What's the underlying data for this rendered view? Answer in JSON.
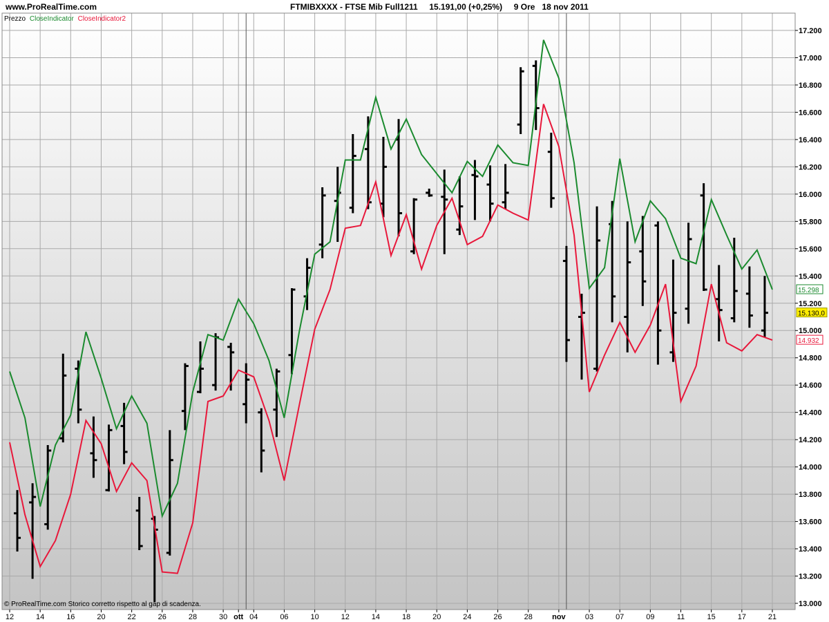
{
  "header": {
    "site": "www.ProRealTime.com",
    "title": "FTMIBXXXX - FTSE Mib Full1211     15.191,00 (+0,25%)     9 Ore   18 nov 2011"
  },
  "legend": {
    "price_label": "Prezzo",
    "ind1_label": "CloseIndicator",
    "ind2_label": "CloseIndicator2"
  },
  "footer": {
    "text": "© ProRealTime.com  Storico corretto rispetto al gap di scadenza."
  },
  "badges": {
    "ind1": "15.298",
    "price": "15.130,0",
    "ind2": "14.932"
  },
  "colors": {
    "ind1": "#1a8a2e",
    "ind2": "#e8173a",
    "price": "#000000",
    "badge_price_bg": "#ffee00"
  },
  "chart_data": {
    "type": "line",
    "y_axis": {
      "range": [
        12900,
        17250
      ],
      "ticks": [
        {
          "v": 13000,
          "label": "13.000"
        },
        {
          "v": 13200,
          "label": "13.200"
        },
        {
          "v": 13400,
          "label": "13.400"
        },
        {
          "v": 13600,
          "label": "13.600"
        },
        {
          "v": 13800,
          "label": "13.800"
        },
        {
          "v": 14000,
          "label": "14.000"
        },
        {
          "v": 14200,
          "label": "14.200"
        },
        {
          "v": 14400,
          "label": "14.400"
        },
        {
          "v": 14600,
          "label": "14.600"
        },
        {
          "v": 14800,
          "label": "14.800"
        },
        {
          "v": 15000,
          "label": "15.000"
        },
        {
          "v": 15200,
          "label": "15.200"
        },
        {
          "v": 15400,
          "label": "15.400"
        },
        {
          "v": 15600,
          "label": "15.600"
        },
        {
          "v": 15800,
          "label": "15.800"
        },
        {
          "v": 16000,
          "label": "16.000"
        },
        {
          "v": 16200,
          "label": "16.200"
        },
        {
          "v": 16400,
          "label": "16.400"
        },
        {
          "v": 16600,
          "label": "16.600"
        },
        {
          "v": 16800,
          "label": "16.800"
        },
        {
          "v": 17000,
          "label": "17.000"
        },
        {
          "v": 17200,
          "label": "17.200"
        }
      ],
      "bold_every": 5000
    },
    "x_axis": {
      "range": [
        -0.3,
        51.2
      ],
      "ticks": [
        {
          "i": 0,
          "label": "12"
        },
        {
          "i": 2,
          "label": "14"
        },
        {
          "i": 4,
          "label": "16"
        },
        {
          "i": 6,
          "label": "20"
        },
        {
          "i": 8,
          "label": "22"
        },
        {
          "i": 10,
          "label": "26"
        },
        {
          "i": 12,
          "label": "28"
        },
        {
          "i": 14,
          "label": "30"
        },
        {
          "i": 15,
          "label": "ott",
          "bold": true
        },
        {
          "i": 16,
          "label": "04"
        },
        {
          "i": 18,
          "label": "06"
        },
        {
          "i": 20,
          "label": "10"
        },
        {
          "i": 22,
          "label": "12"
        },
        {
          "i": 24,
          "label": "14"
        },
        {
          "i": 26,
          "label": "18"
        },
        {
          "i": 28,
          "label": "20"
        },
        {
          "i": 30,
          "label": "24"
        },
        {
          "i": 32,
          "label": "26"
        },
        {
          "i": 34,
          "label": "28"
        },
        {
          "i": 36,
          "label": "nov",
          "bold": true
        },
        {
          "i": 38,
          "label": "03"
        },
        {
          "i": 40,
          "label": "07"
        },
        {
          "i": 42,
          "label": "09"
        },
        {
          "i": 44,
          "label": "11"
        },
        {
          "i": 46,
          "label": "15"
        },
        {
          "i": 48,
          "label": "17"
        },
        {
          "i": 50,
          "label": "21"
        }
      ],
      "month_separators": [
        15.5,
        36.5
      ]
    },
    "price_bars": [
      {
        "i": 0.5,
        "h": 13830,
        "l": 13380,
        "o": 13660,
        "c": 13480
      },
      {
        "i": 1.5,
        "h": 13880,
        "l": 13180,
        "o": 13740,
        "c": 13780
      },
      {
        "i": 2.5,
        "h": 14160,
        "l": 13540,
        "o": 13580,
        "c": 14120
      },
      {
        "i": 3.5,
        "h": 14830,
        "l": 14180,
        "o": 14210,
        "c": 14670
      },
      {
        "i": 4.5,
        "h": 14780,
        "l": 14320,
        "o": 14720,
        "c": 14420
      },
      {
        "i": 5.5,
        "h": 14370,
        "l": 13920,
        "o": 14100,
        "c": 14050
      },
      {
        "i": 6.5,
        "h": 14310,
        "l": 13820,
        "o": 13830,
        "c": 14270
      },
      {
        "i": 7.5,
        "h": 14470,
        "l": 14020,
        "o": 14300,
        "c": 14110
      },
      {
        "i": 8.5,
        "h": 13780,
        "l": 13390,
        "o": 13680,
        "c": 13420
      },
      {
        "i": 9.5,
        "h": 13640,
        "l": 13010,
        "o": 13620,
        "c": 13540
      },
      {
        "i": 10.5,
        "h": 14270,
        "l": 13350,
        "o": 13370,
        "c": 14050
      },
      {
        "i": 11.5,
        "h": 14760,
        "l": 14270,
        "o": 14410,
        "c": 14740
      },
      {
        "i": 12.5,
        "h": 14920,
        "l": 14540,
        "o": 14550,
        "c": 14720
      },
      {
        "i": 13.5,
        "h": 14980,
        "l": 14560,
        "o": 14600,
        "c": 14950
      },
      {
        "i": 14.5,
        "h": 14910,
        "l": 14560,
        "o": 14880,
        "c": 14840
      },
      {
        "i": 15.5,
        "h": 14760,
        "l": 14320,
        "o": 14460,
        "c": 14640
      },
      {
        "i": 16.5,
        "h": 14430,
        "l": 13960,
        "o": 14400,
        "c": 14120
      },
      {
        "i": 17.5,
        "h": 14720,
        "l": 14220,
        "o": 14420,
        "c": 14700
      },
      {
        "i": 18.5,
        "h": 15310,
        "l": 14680,
        "o": 14820,
        "c": 15300
      },
      {
        "i": 19.5,
        "h": 15530,
        "l": 15150,
        "o": 15250,
        "c": 15460
      },
      {
        "i": 20.5,
        "h": 16050,
        "l": 15530,
        "o": 15630,
        "c": 15990
      },
      {
        "i": 21.5,
        "h": 16200,
        "l": 15650,
        "o": 15950,
        "c": 16010
      },
      {
        "i": 22.5,
        "h": 16440,
        "l": 15860,
        "o": 15900,
        "c": 16280
      },
      {
        "i": 23.5,
        "h": 16570,
        "l": 15890,
        "o": 16330,
        "c": 15940
      },
      {
        "i": 24.5,
        "h": 16420,
        "l": 15830,
        "o": 15930,
        "c": 16200
      },
      {
        "i": 25.5,
        "h": 16550,
        "l": 15690,
        "o": 16400,
        "c": 15860
      },
      {
        "i": 26.5,
        "h": 15970,
        "l": 15560,
        "o": 15580,
        "c": 15960
      },
      {
        "i": 27.5,
        "h": 16040,
        "l": 15980,
        "o": 16010,
        "c": 15990
      },
      {
        "i": 28.5,
        "h": 16180,
        "l": 15560,
        "o": 15980,
        "c": 15960
      },
      {
        "i": 29.5,
        "h": 16130,
        "l": 15700,
        "o": 15740,
        "c": 15910
      },
      {
        "i": 30.5,
        "h": 16250,
        "l": 15810,
        "o": 16140,
        "c": 16130
      },
      {
        "i": 31.5,
        "h": 16210,
        "l": 15800,
        "o": 16070,
        "c": 15930
      },
      {
        "i": 32.5,
        "h": 16220,
        "l": 15890,
        "o": 15940,
        "c": 16010
      },
      {
        "i": 33.5,
        "h": 16930,
        "l": 16440,
        "o": 16510,
        "c": 16900
      },
      {
        "i": 34.5,
        "h": 16980,
        "l": 16470,
        "o": 16940,
        "c": 16630
      },
      {
        "i": 35.5,
        "h": 16450,
        "l": 15900,
        "o": 16310,
        "c": 15970
      },
      {
        "i": 36.5,
        "h": 15620,
        "l": 14770,
        "o": 15510,
        "c": 14930
      },
      {
        "i": 37.5,
        "h": 15270,
        "l": 14640,
        "o": 15100,
        "c": 15130
      },
      {
        "i": 38.5,
        "h": 15910,
        "l": 14700,
        "o": 14720,
        "c": 15660
      },
      {
        "i": 39.5,
        "h": 15950,
        "l": 15060,
        "o": 15780,
        "c": 15250
      },
      {
        "i": 40.5,
        "h": 15800,
        "l": 14840,
        "o": 15100,
        "c": 15500
      },
      {
        "i": 41.5,
        "h": 15840,
        "l": 15180,
        "o": 15580,
        "c": 15360
      },
      {
        "i": 42.5,
        "h": 15800,
        "l": 14750,
        "o": 15770,
        "c": 15000
      },
      {
        "i": 43.5,
        "h": 15520,
        "l": 14770,
        "o": 14840,
        "c": 15130
      },
      {
        "i": 44.5,
        "h": 15790,
        "l": 15050,
        "o": 15160,
        "c": 15670
      },
      {
        "i": 45.5,
        "h": 16080,
        "l": 15290,
        "o": 15990,
        "c": 15300
      },
      {
        "i": 46.5,
        "h": 15480,
        "l": 14920,
        "o": 15230,
        "c": 15150
      },
      {
        "i": 47.5,
        "h": 15680,
        "l": 15060,
        "o": 15090,
        "c": 15290
      },
      {
        "i": 48.5,
        "h": 15470,
        "l": 15020,
        "o": 15270,
        "c": 15110
      },
      {
        "i": 49.5,
        "h": 15400,
        "l": 14950,
        "o": 15000,
        "c": 15130
      }
    ],
    "series": [
      {
        "name": "CloseIndicator",
        "color": "#1a8a2e",
        "points": [
          [
            0,
            14700
          ],
          [
            1,
            14360
          ],
          [
            2,
            13710
          ],
          [
            3,
            14160
          ],
          [
            4,
            14380
          ],
          [
            5,
            14990
          ],
          [
            6,
            14650
          ],
          [
            7,
            14280
          ],
          [
            8,
            14520
          ],
          [
            9,
            14320
          ],
          [
            10,
            13640
          ],
          [
            11,
            13880
          ],
          [
            12,
            14550
          ],
          [
            13,
            14970
          ],
          [
            14,
            14930
          ],
          [
            15,
            15230
          ],
          [
            16,
            15050
          ],
          [
            17,
            14780
          ],
          [
            18,
            14360
          ],
          [
            19,
            15000
          ],
          [
            20,
            15560
          ],
          [
            21,
            15650
          ],
          [
            22,
            16250
          ],
          [
            23,
            16250
          ],
          [
            24,
            16710
          ],
          [
            25,
            16330
          ],
          [
            26,
            16550
          ],
          [
            27,
            16290
          ],
          [
            28,
            16150
          ],
          [
            29,
            16010
          ],
          [
            30,
            16240
          ],
          [
            31,
            16130
          ],
          [
            32,
            16360
          ],
          [
            33,
            16230
          ],
          [
            34,
            16210
          ],
          [
            35,
            17130
          ],
          [
            36,
            16850
          ],
          [
            37,
            16230
          ],
          [
            38,
            15310
          ],
          [
            39,
            15460
          ],
          [
            40,
            16260
          ],
          [
            41,
            15650
          ],
          [
            42,
            15950
          ],
          [
            43,
            15820
          ],
          [
            44,
            15530
          ],
          [
            45,
            15490
          ],
          [
            46,
            15960
          ],
          [
            47,
            15700
          ],
          [
            48,
            15450
          ],
          [
            49,
            15590
          ],
          [
            50,
            15300
          ]
        ]
      },
      {
        "name": "CloseIndicator2",
        "color": "#e8173a",
        "points": [
          [
            0,
            14180
          ],
          [
            1,
            13650
          ],
          [
            2,
            13270
          ],
          [
            3,
            13460
          ],
          [
            4,
            13800
          ],
          [
            5,
            14340
          ],
          [
            6,
            14170
          ],
          [
            7,
            13820
          ],
          [
            8,
            14030
          ],
          [
            9,
            13900
          ],
          [
            10,
            13230
          ],
          [
            11,
            13220
          ],
          [
            12,
            13590
          ],
          [
            13,
            14480
          ],
          [
            14,
            14520
          ],
          [
            15,
            14710
          ],
          [
            16,
            14660
          ],
          [
            17,
            14340
          ],
          [
            18,
            13900
          ],
          [
            19,
            14460
          ],
          [
            20,
            15010
          ],
          [
            21,
            15300
          ],
          [
            22,
            15750
          ],
          [
            23,
            15770
          ],
          [
            24,
            16090
          ],
          [
            25,
            15550
          ],
          [
            26,
            15850
          ],
          [
            27,
            15450
          ],
          [
            28,
            15770
          ],
          [
            29,
            15970
          ],
          [
            30,
            15630
          ],
          [
            31,
            15690
          ],
          [
            32,
            15920
          ],
          [
            33,
            15860
          ],
          [
            34,
            15810
          ],
          [
            35,
            16660
          ],
          [
            36,
            16350
          ],
          [
            37,
            15700
          ],
          [
            38,
            14550
          ],
          [
            39,
            14820
          ],
          [
            40,
            15060
          ],
          [
            41,
            14840
          ],
          [
            42,
            15040
          ],
          [
            43,
            15340
          ],
          [
            44,
            14480
          ],
          [
            45,
            14740
          ],
          [
            46,
            15340
          ],
          [
            47,
            14910
          ],
          [
            48,
            14850
          ],
          [
            49,
            14970
          ],
          [
            50,
            14930
          ]
        ]
      }
    ]
  }
}
